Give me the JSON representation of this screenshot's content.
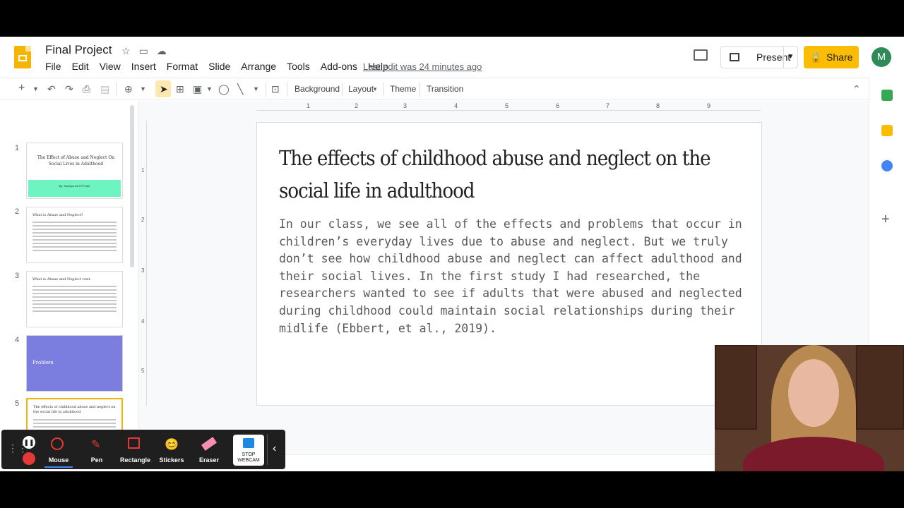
{
  "app": {
    "title": "Final Project",
    "menu": [
      "File",
      "Edit",
      "View",
      "Insert",
      "Format",
      "Slide",
      "Arrange",
      "Tools",
      "Add-ons",
      "Help"
    ],
    "last_edit": "Last edit was 24 minutes ago",
    "present_label": "Present",
    "share_label": "Share",
    "avatar_letter": "M"
  },
  "toolbar": {
    "background": "Background",
    "layout": "Layout",
    "theme": "Theme",
    "transition": "Transition"
  },
  "filmstrip": {
    "slides": [
      {
        "num": "1",
        "title": "The Effect of Abuse and Neglect On Social Lives in Adulthood",
        "band": "By: Sadiqua Ali CFS 562"
      },
      {
        "num": "2",
        "title": "What is Abuse and Neglect?"
      },
      {
        "num": "3",
        "title": "What is Abuse and Neglect cont."
      },
      {
        "num": "4",
        "title": "Problem"
      },
      {
        "num": "5",
        "title": "The effects of childhood abuse and neglect on the social life in adulthood"
      }
    ]
  },
  "ruler": {
    "top": [
      "1",
      "2",
      "3",
      "4",
      "5",
      "6",
      "7",
      "8",
      "9"
    ],
    "left": [
      "1",
      "2",
      "3",
      "4",
      "5"
    ]
  },
  "slide": {
    "title": "The effects of childhood abuse and neglect on the social life in adulthood",
    "body": "In our class, we see all of the effects and problems that occur in children’s everyday lives due to abuse and neglect. But we truly don’t see how childhood abuse and neglect can affect adulthood and their social lives. In the first study I had researched, the researchers wanted to see if adults that were abused and neglected during childhood could maintain social relationships during their midlife (Ebbert, et al., 2019)."
  },
  "castbar": {
    "mouse": "Mouse",
    "pen": "Pen",
    "rectangle": "Rectangle",
    "stickers": "Stickers",
    "eraser": "Eraser",
    "stop_webcam": "STOP WEBCAM"
  },
  "colors": {
    "accent": "#fbbc04",
    "thumb_band": "#6ef4c1",
    "problem_slide": "#7b7ddf"
  }
}
